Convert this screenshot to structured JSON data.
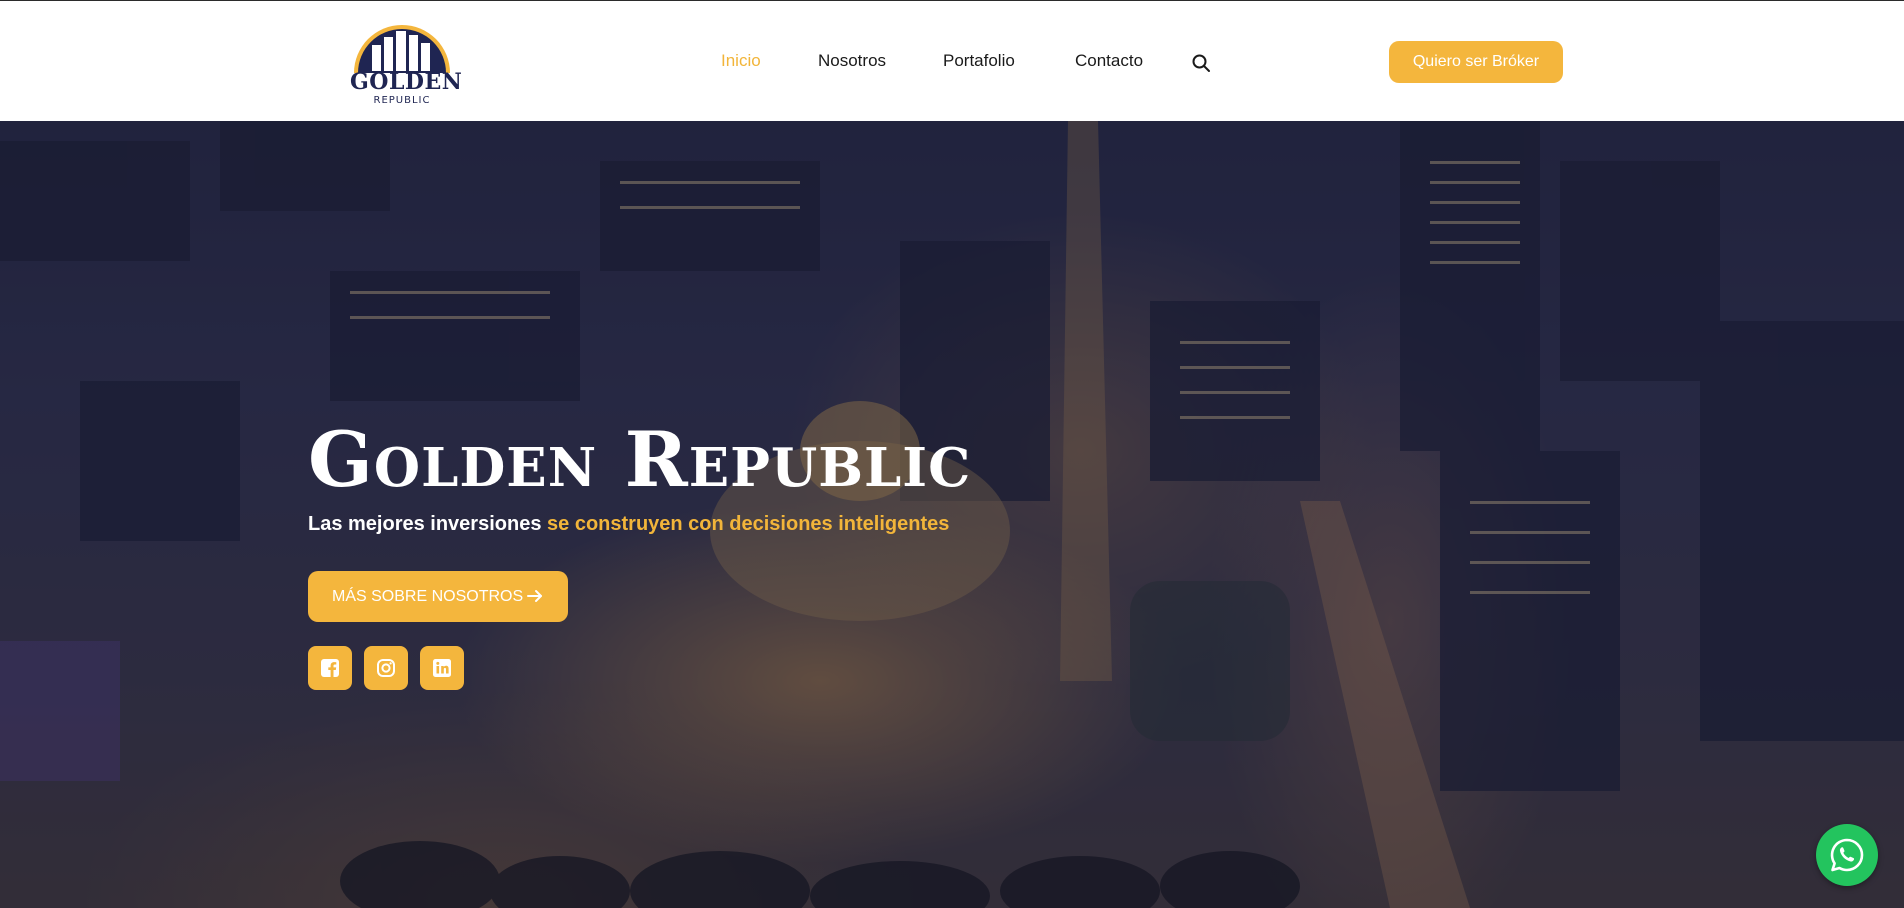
{
  "brand": {
    "logo_word": "GOLDEN",
    "logo_sub": "REPUBLIC"
  },
  "nav": {
    "items": [
      {
        "label": "Inicio",
        "active": true
      },
      {
        "label": "Nosotros",
        "active": false
      },
      {
        "label": "Portafolio",
        "active": false
      },
      {
        "label": "Contacto",
        "active": false
      }
    ],
    "search_icon": "search-icon",
    "cta_label": "Quiero ser Bróker"
  },
  "hero": {
    "title": "Golden Republic",
    "subtitle_white": "Las mejores inversiones",
    "subtitle_gold": "se construyen con decisiones inteligentes",
    "cta_label": "MÁS SOBRE NOSOTROS",
    "cta_icon": "arrow-right-icon",
    "social": [
      {
        "name": "facebook",
        "icon": "facebook-icon"
      },
      {
        "name": "instagram",
        "icon": "instagram-icon"
      },
      {
        "name": "linkedin",
        "icon": "linkedin-icon"
      }
    ]
  },
  "floating": {
    "whatsapp_icon": "whatsapp-icon"
  },
  "colors": {
    "accent": "#f4b63d",
    "navy": "#1f2552",
    "whatsapp": "#23c45e"
  }
}
